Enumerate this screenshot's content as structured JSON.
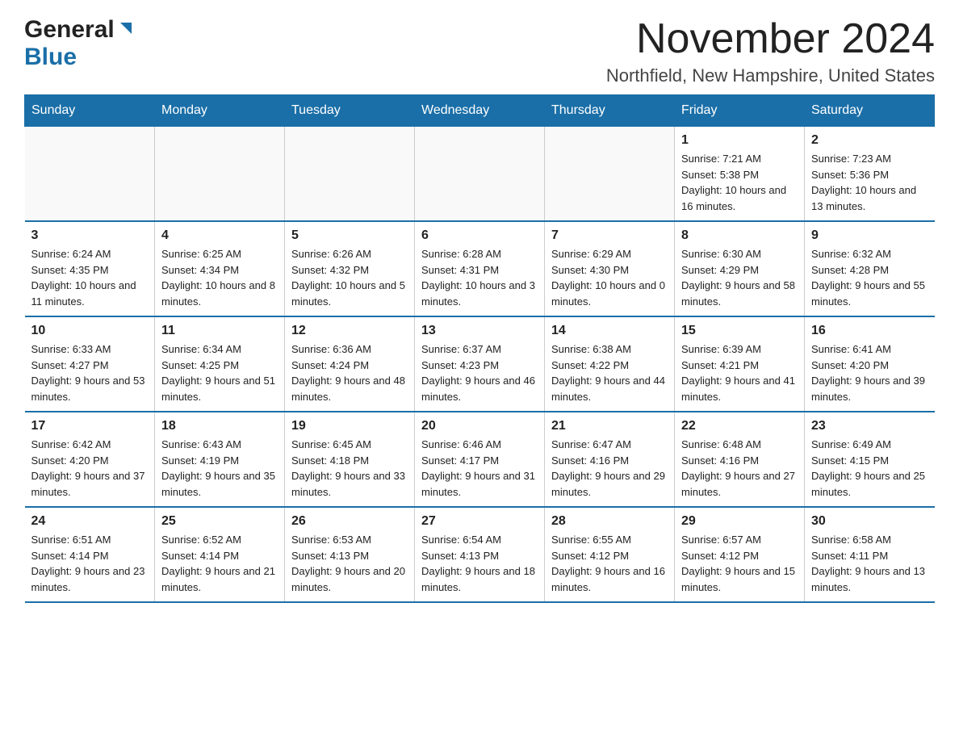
{
  "header": {
    "logo_general": "General",
    "logo_blue": "Blue",
    "title": "November 2024",
    "subtitle": "Northfield, New Hampshire, United States"
  },
  "days_of_week": [
    "Sunday",
    "Monday",
    "Tuesday",
    "Wednesday",
    "Thursday",
    "Friday",
    "Saturday"
  ],
  "weeks": [
    [
      {
        "day": "",
        "info": ""
      },
      {
        "day": "",
        "info": ""
      },
      {
        "day": "",
        "info": ""
      },
      {
        "day": "",
        "info": ""
      },
      {
        "day": "",
        "info": ""
      },
      {
        "day": "1",
        "info": "Sunrise: 7:21 AM\nSunset: 5:38 PM\nDaylight: 10 hours and 16 minutes."
      },
      {
        "day": "2",
        "info": "Sunrise: 7:23 AM\nSunset: 5:36 PM\nDaylight: 10 hours and 13 minutes."
      }
    ],
    [
      {
        "day": "3",
        "info": "Sunrise: 6:24 AM\nSunset: 4:35 PM\nDaylight: 10 hours and 11 minutes."
      },
      {
        "day": "4",
        "info": "Sunrise: 6:25 AM\nSunset: 4:34 PM\nDaylight: 10 hours and 8 minutes."
      },
      {
        "day": "5",
        "info": "Sunrise: 6:26 AM\nSunset: 4:32 PM\nDaylight: 10 hours and 5 minutes."
      },
      {
        "day": "6",
        "info": "Sunrise: 6:28 AM\nSunset: 4:31 PM\nDaylight: 10 hours and 3 minutes."
      },
      {
        "day": "7",
        "info": "Sunrise: 6:29 AM\nSunset: 4:30 PM\nDaylight: 10 hours and 0 minutes."
      },
      {
        "day": "8",
        "info": "Sunrise: 6:30 AM\nSunset: 4:29 PM\nDaylight: 9 hours and 58 minutes."
      },
      {
        "day": "9",
        "info": "Sunrise: 6:32 AM\nSunset: 4:28 PM\nDaylight: 9 hours and 55 minutes."
      }
    ],
    [
      {
        "day": "10",
        "info": "Sunrise: 6:33 AM\nSunset: 4:27 PM\nDaylight: 9 hours and 53 minutes."
      },
      {
        "day": "11",
        "info": "Sunrise: 6:34 AM\nSunset: 4:25 PM\nDaylight: 9 hours and 51 minutes."
      },
      {
        "day": "12",
        "info": "Sunrise: 6:36 AM\nSunset: 4:24 PM\nDaylight: 9 hours and 48 minutes."
      },
      {
        "day": "13",
        "info": "Sunrise: 6:37 AM\nSunset: 4:23 PM\nDaylight: 9 hours and 46 minutes."
      },
      {
        "day": "14",
        "info": "Sunrise: 6:38 AM\nSunset: 4:22 PM\nDaylight: 9 hours and 44 minutes."
      },
      {
        "day": "15",
        "info": "Sunrise: 6:39 AM\nSunset: 4:21 PM\nDaylight: 9 hours and 41 minutes."
      },
      {
        "day": "16",
        "info": "Sunrise: 6:41 AM\nSunset: 4:20 PM\nDaylight: 9 hours and 39 minutes."
      }
    ],
    [
      {
        "day": "17",
        "info": "Sunrise: 6:42 AM\nSunset: 4:20 PM\nDaylight: 9 hours and 37 minutes."
      },
      {
        "day": "18",
        "info": "Sunrise: 6:43 AM\nSunset: 4:19 PM\nDaylight: 9 hours and 35 minutes."
      },
      {
        "day": "19",
        "info": "Sunrise: 6:45 AM\nSunset: 4:18 PM\nDaylight: 9 hours and 33 minutes."
      },
      {
        "day": "20",
        "info": "Sunrise: 6:46 AM\nSunset: 4:17 PM\nDaylight: 9 hours and 31 minutes."
      },
      {
        "day": "21",
        "info": "Sunrise: 6:47 AM\nSunset: 4:16 PM\nDaylight: 9 hours and 29 minutes."
      },
      {
        "day": "22",
        "info": "Sunrise: 6:48 AM\nSunset: 4:16 PM\nDaylight: 9 hours and 27 minutes."
      },
      {
        "day": "23",
        "info": "Sunrise: 6:49 AM\nSunset: 4:15 PM\nDaylight: 9 hours and 25 minutes."
      }
    ],
    [
      {
        "day": "24",
        "info": "Sunrise: 6:51 AM\nSunset: 4:14 PM\nDaylight: 9 hours and 23 minutes."
      },
      {
        "day": "25",
        "info": "Sunrise: 6:52 AM\nSunset: 4:14 PM\nDaylight: 9 hours and 21 minutes."
      },
      {
        "day": "26",
        "info": "Sunrise: 6:53 AM\nSunset: 4:13 PM\nDaylight: 9 hours and 20 minutes."
      },
      {
        "day": "27",
        "info": "Sunrise: 6:54 AM\nSunset: 4:13 PM\nDaylight: 9 hours and 18 minutes."
      },
      {
        "day": "28",
        "info": "Sunrise: 6:55 AM\nSunset: 4:12 PM\nDaylight: 9 hours and 16 minutes."
      },
      {
        "day": "29",
        "info": "Sunrise: 6:57 AM\nSunset: 4:12 PM\nDaylight: 9 hours and 15 minutes."
      },
      {
        "day": "30",
        "info": "Sunrise: 6:58 AM\nSunset: 4:11 PM\nDaylight: 9 hours and 13 minutes."
      }
    ]
  ]
}
